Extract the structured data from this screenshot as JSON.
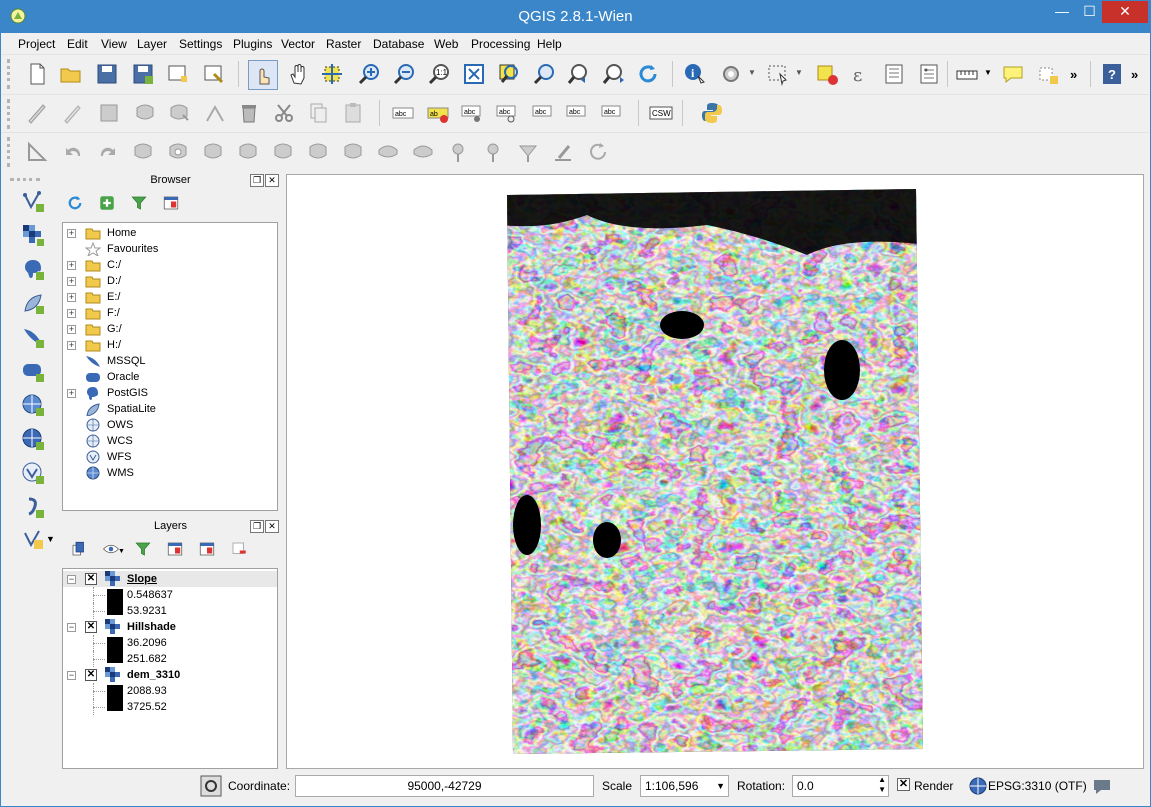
{
  "window": {
    "title": "QGIS 2.8.1-Wien",
    "minimize": "—",
    "maximize": "☐",
    "close": "✕"
  },
  "menu": [
    "Project",
    "Edit",
    "View",
    "Layer",
    "Settings",
    "Plugins",
    "Vector",
    "Raster",
    "Database",
    "Web",
    "Processing",
    "Help"
  ],
  "toolbar_more": "»",
  "browser": {
    "title": "Browser",
    "items": [
      {
        "label": "Home",
        "icon": "folder-icon",
        "expandable": true
      },
      {
        "label": "Favourites",
        "icon": "star-icon",
        "expandable": false
      },
      {
        "label": "C:/",
        "icon": "folder-icon",
        "expandable": true
      },
      {
        "label": "D:/",
        "icon": "folder-icon",
        "expandable": true
      },
      {
        "label": "E:/",
        "icon": "folder-icon",
        "expandable": true
      },
      {
        "label": "F:/",
        "icon": "folder-icon",
        "expandable": true
      },
      {
        "label": "G:/",
        "icon": "folder-icon",
        "expandable": true
      },
      {
        "label": "H:/",
        "icon": "folder-icon",
        "expandable": true
      },
      {
        "label": "MSSQL",
        "icon": "mssql-icon",
        "expandable": false
      },
      {
        "label": "Oracle",
        "icon": "oracle-icon",
        "expandable": false
      },
      {
        "label": "PostGIS",
        "icon": "postgis-icon",
        "expandable": true
      },
      {
        "label": "SpatiaLite",
        "icon": "spatialite-icon",
        "expandable": false
      },
      {
        "label": "OWS",
        "icon": "ows-icon",
        "expandable": false
      },
      {
        "label": "WCS",
        "icon": "wcs-icon",
        "expandable": false
      },
      {
        "label": "WFS",
        "icon": "wfs-icon",
        "expandable": false
      },
      {
        "label": "WMS",
        "icon": "wms-icon",
        "expandable": false
      }
    ]
  },
  "layers": {
    "title": "Layers",
    "items": [
      {
        "name": "Slope",
        "min": "0.548637",
        "max": "53.9231",
        "visible": true,
        "current": true
      },
      {
        "name": "Hillshade",
        "min": "36.2096",
        "max": "251.682",
        "visible": true,
        "current": false
      },
      {
        "name": "dem_3310",
        "min": "2088.93",
        "max": "3725.52",
        "visible": true,
        "current": false
      }
    ]
  },
  "status": {
    "coordinate_label": "Coordinate:",
    "coordinate_value": "95000,-42729",
    "scale_label": "Scale",
    "scale_value": "1:106,596",
    "rotation_label": "Rotation:",
    "rotation_value": "0.0",
    "render_label": "Render",
    "render_checked": true,
    "crs": "EPSG:3310 (OTF)"
  },
  "colors": {
    "titlebar": "#3a86c8",
    "close": "#c7312a"
  }
}
